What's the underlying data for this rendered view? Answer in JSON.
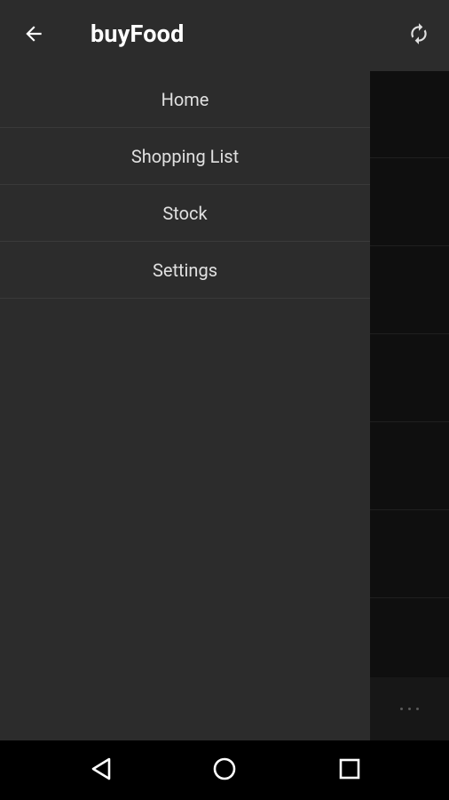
{
  "app_bar": {
    "title": "buyFood",
    "back_icon": "arrow-back-icon",
    "refresh_icon": "refresh-icon"
  },
  "drawer": {
    "items": [
      {
        "label": "Home"
      },
      {
        "label": "Shopping List"
      },
      {
        "label": "Stock"
      },
      {
        "label": "Settings"
      }
    ]
  },
  "background": {
    "overflow_icon": "more-horizontal-icon"
  },
  "system_nav": {
    "back_icon": "nav-back-icon",
    "home_icon": "nav-home-icon",
    "recents_icon": "nav-recents-icon"
  },
  "colors": {
    "app_bar": "#2c2c2c",
    "drawer": "#2c2c2c",
    "divider": "#3a3a3a",
    "text_primary": "#ffffff",
    "text_item": "#e0e0e0",
    "background_dim": "#0f0f0f"
  }
}
